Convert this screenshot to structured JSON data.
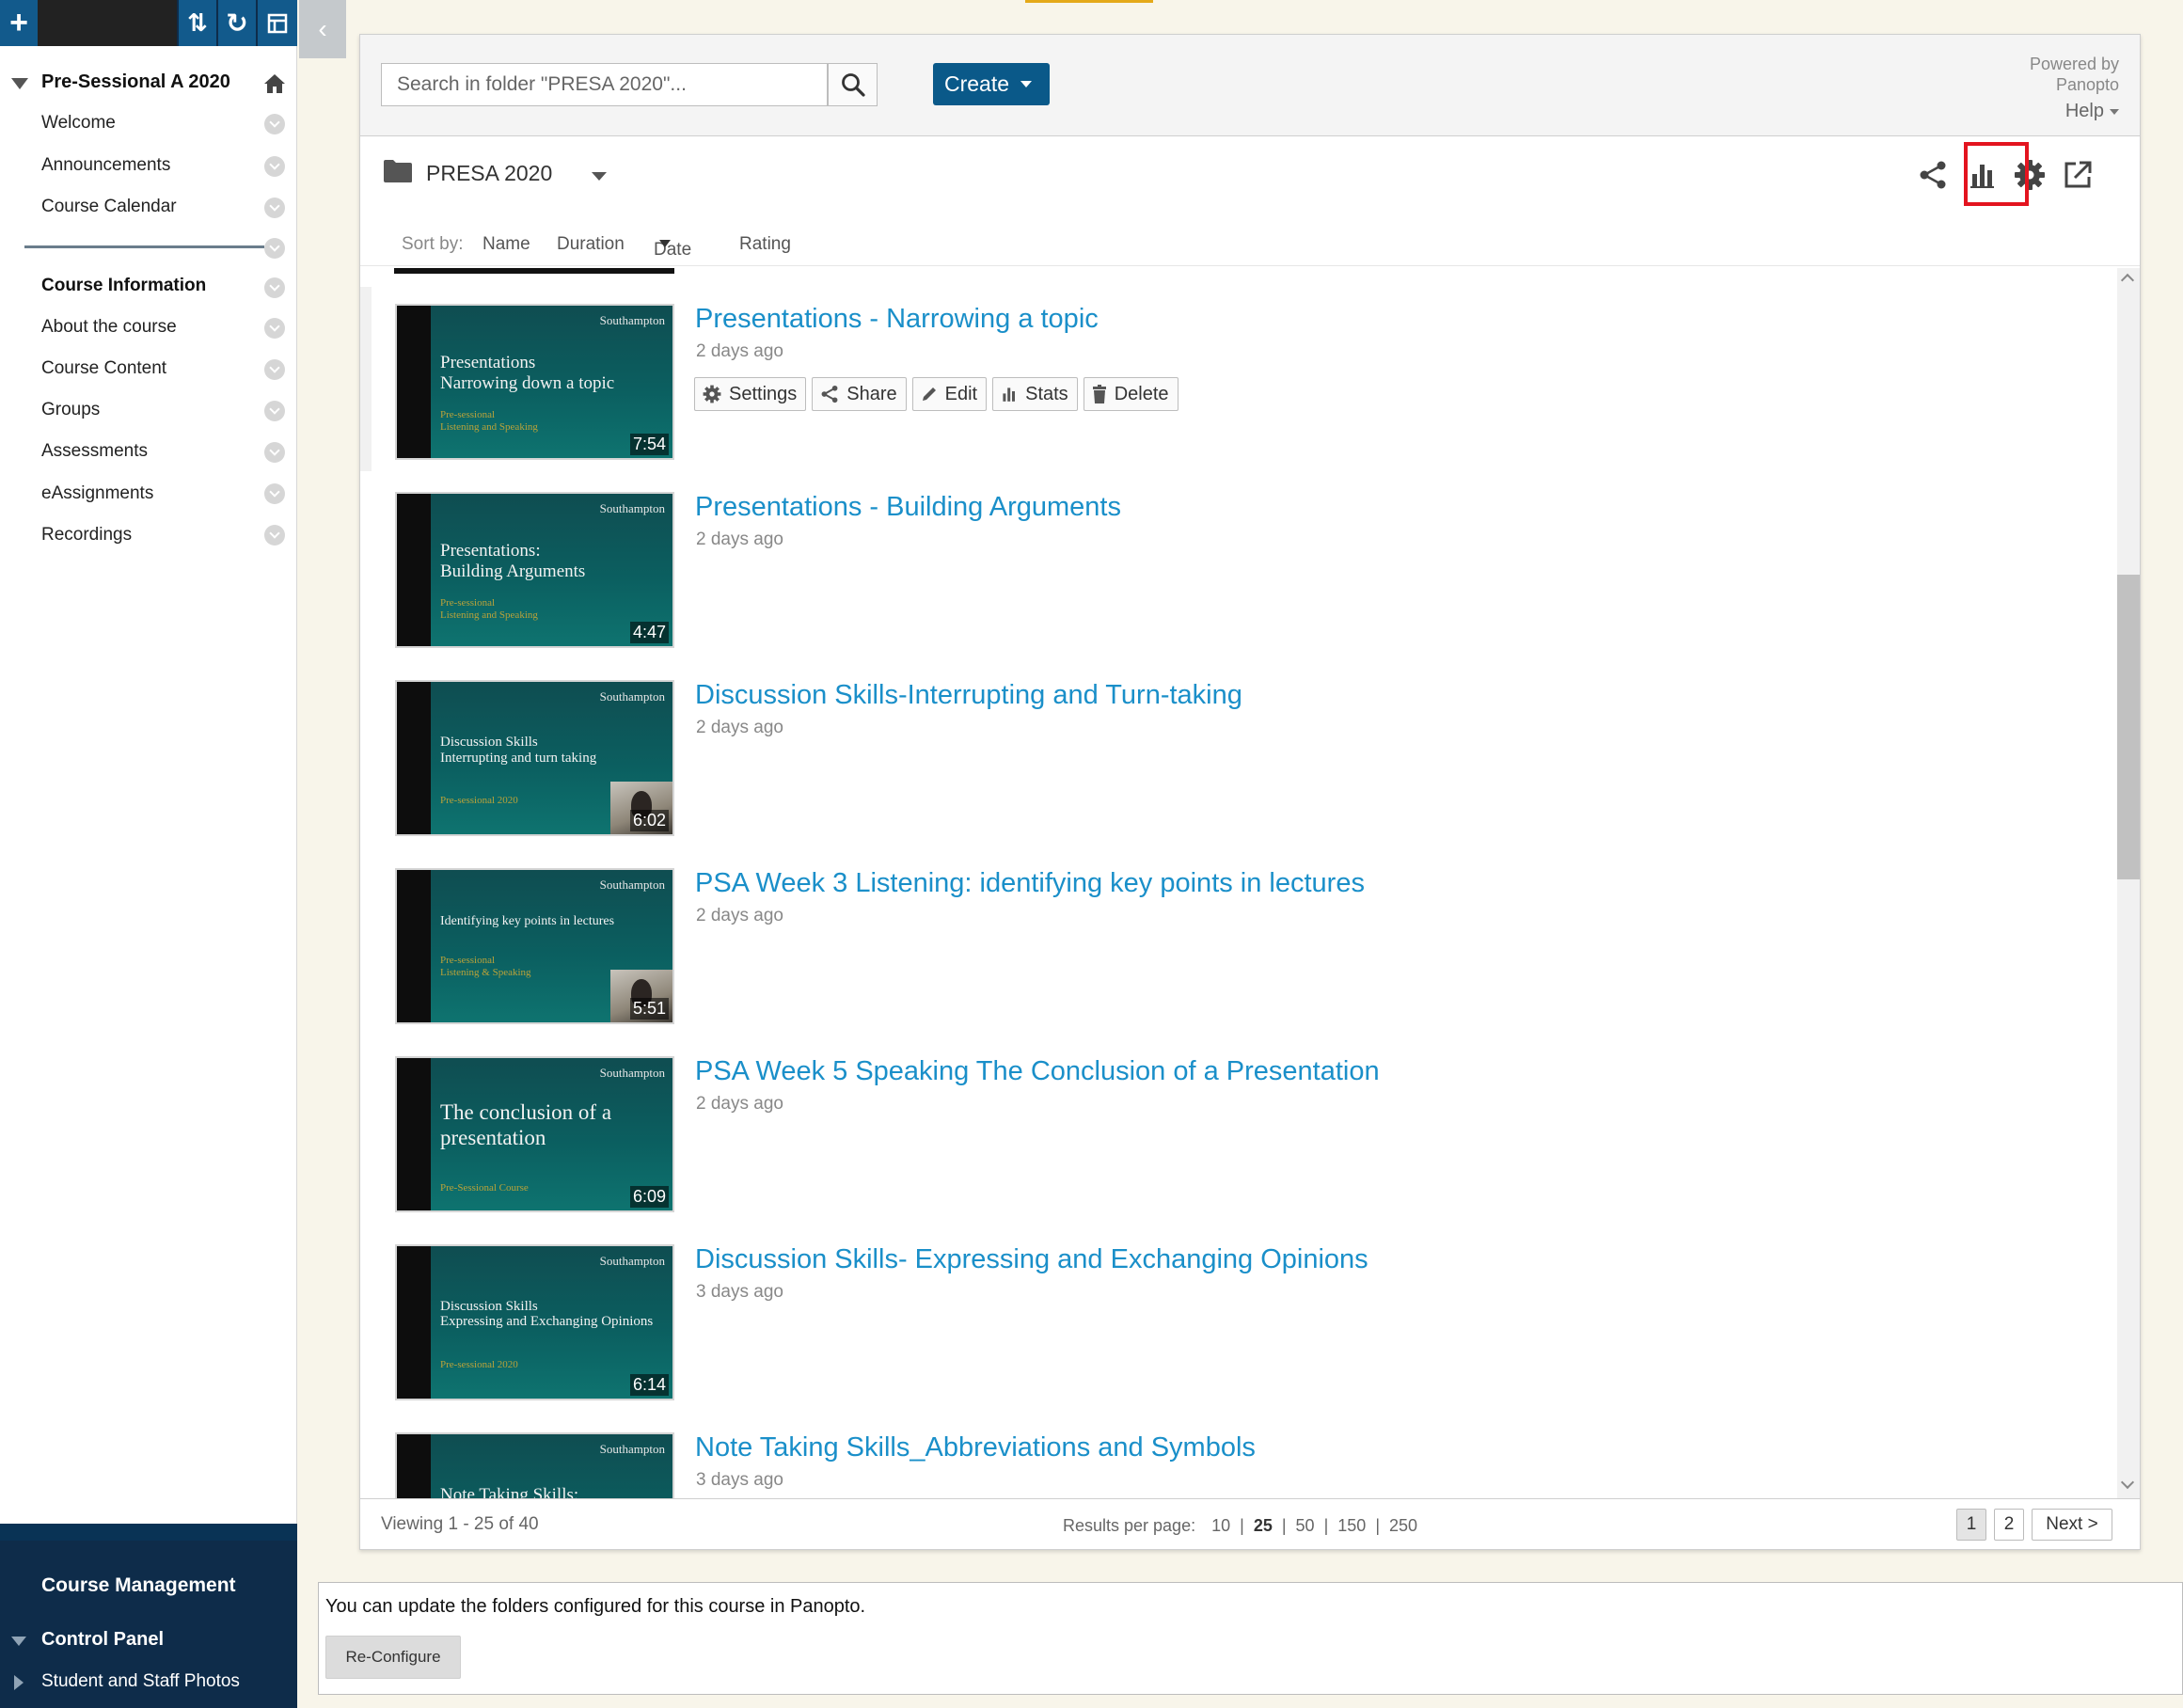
{
  "sidebar": {
    "course_title": "Pre-Sessional A 2020",
    "items": [
      {
        "label": "Welcome"
      },
      {
        "label": "Announcements"
      },
      {
        "label": "Course Calendar"
      },
      {
        "label": "Course Information"
      },
      {
        "label": "About the course"
      },
      {
        "label": "Course Content"
      },
      {
        "label": "Groups"
      },
      {
        "label": "Assessments"
      },
      {
        "label": "eAssignments"
      },
      {
        "label": "Recordings"
      }
    ],
    "management_title": "Course Management",
    "control_panel": "Control Panel",
    "student_photos": "Student and Staff Photos"
  },
  "header": {
    "search_placeholder": "Search in folder \"PRESA 2020\"...",
    "create_label": "Create",
    "powered_line1": "Powered by",
    "powered_line2": "Panopto",
    "help_label": "Help"
  },
  "folder": {
    "name": "PRESA 2020",
    "icons": [
      "share-icon",
      "stats-icon",
      "settings-icon",
      "open-external-icon"
    ]
  },
  "sort": {
    "label": "Sort by:",
    "options": [
      "Name",
      "Duration",
      "Date",
      "Rating"
    ],
    "active": "Date"
  },
  "sessions": [
    {
      "title": "Presentations - Narrowing a topic",
      "date": "2 days ago",
      "duration": "7:54",
      "thumb_line1": "Presentations",
      "thumb_line2": "Narrowing down a topic",
      "thumb_sub1": "Pre-sessional",
      "thumb_sub2": "Listening and Speaking"
    },
    {
      "title": "Presentations - Building Arguments",
      "date": "2 days ago",
      "duration": "4:47",
      "thumb_line1": "Presentations:",
      "thumb_line2": "Building Arguments",
      "thumb_sub1": "Pre-sessional",
      "thumb_sub2": "Listening and Speaking"
    },
    {
      "title": "Discussion Skills-Interrupting and Turn-taking",
      "date": "2 days ago",
      "duration": "6:02",
      "thumb_line1": "Discussion Skills",
      "thumb_line2": "Interrupting and turn taking",
      "thumb_sub1": "Pre-sessional 2020",
      "thumb_sub2": ""
    },
    {
      "title": "PSA Week 3 Listening: identifying key points in lectures",
      "date": "2 days ago",
      "duration": "5:51",
      "thumb_line1": "Identifying key points in lectures",
      "thumb_line2": "",
      "thumb_sub1": "Pre-sessional",
      "thumb_sub2": "Listening & Speaking"
    },
    {
      "title": "PSA Week 5 Speaking The Conclusion of a Presentation",
      "date": "2 days ago",
      "duration": "6:09",
      "thumb_line1": "The conclusion of a",
      "thumb_line2": "presentation",
      "thumb_sub1": "Pre-Sessional Course",
      "thumb_sub2": ""
    },
    {
      "title": "Discussion Skills- Expressing and Exchanging Opinions",
      "date": "3 days ago",
      "duration": "6:14",
      "thumb_line1": "Discussion Skills",
      "thumb_line2": "Expressing and Exchanging Opinions",
      "thumb_sub1": "Pre-sessional 2020",
      "thumb_sub2": ""
    },
    {
      "title": "Note Taking Skills_Abbreviations and Symbols",
      "date": "3 days ago",
      "duration": "",
      "thumb_line1": "Note Taking Skills:",
      "thumb_line2": "",
      "thumb_sub1": "",
      "thumb_sub2": ""
    }
  ],
  "thumb_brand": "Southampton",
  "row_actions": {
    "settings": "Settings",
    "share": "Share",
    "edit": "Edit",
    "stats": "Stats",
    "delete": "Delete"
  },
  "footer": {
    "viewing": "Viewing 1 - 25 of 40",
    "results_label": "Results per page:",
    "per_page_options": [
      "10",
      "25",
      "50",
      "150",
      "250"
    ],
    "per_page_selected": "25",
    "pages": [
      "1",
      "2"
    ],
    "current_page": "1",
    "next_label": "Next >"
  },
  "reconfigure": {
    "message": "You can update the folders configured for this course in Panopto.",
    "button_label": "Re-Configure"
  },
  "colors": {
    "brand_dark": "#0e2c4a",
    "accent_blue": "#0a5989",
    "link_blue": "#1a8fc9",
    "highlight_red": "#e3141f"
  }
}
